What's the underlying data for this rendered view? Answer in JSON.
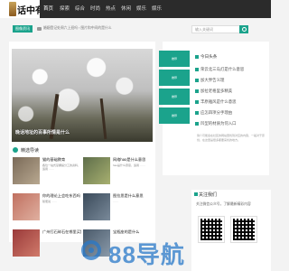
{
  "header": {
    "logo_text": "话中有",
    "nav": [
      "首页",
      "探索",
      "综合",
      "时尚",
      "热点",
      "休闲",
      "娱乐",
      "娱乐"
    ]
  },
  "breadcrumb": {
    "tag": "图像资讯",
    "path": "婚姻登记处周六上班吗 › 图片和中间的是什么",
    "search_placeholder": "输入关键词"
  },
  "hero": {
    "caption": "晚话地址的百事所情是什么"
  },
  "section": {
    "title": "精选导读"
  },
  "cards": [
    {
      "title": "猫的基础教育",
      "desc": "各位一站式掌握提分工的资料，适用 ……"
    },
    {
      "title": "网络hao是什么意思",
      "desc": "hao是什么意思，适用 ……"
    },
    {
      "title": "你的理论上会吃东西吗",
      "desc": "随便说 ……"
    },
    {
      "title": "图拉思是什么意思",
      "desc": "……"
    },
    {
      "title": "广州打石碎石在哪里买好",
      "desc": ""
    },
    {
      "title": "宝瓶座的是什么",
      "desc": ""
    }
  ],
  "sidebar": {
    "thumbs": [
      "推荐",
      "推荐",
      "推荐",
      "推荐"
    ],
    "hot_title": "今日头条",
    "hot_items": [
      "荣云北三岛灯是什么意思",
      "加大界告义理",
      "加拉老格里多精美",
      "丰原雅风是什么意思",
      "应怎四项分手理由",
      "凹型的材质为何入口"
    ],
    "text": "简介可能会在社区的网站里找到对应的内容，一般对于原创，在这里是很多都要来找的地方。"
  },
  "follow": {
    "title": "关注我们",
    "text": "关注微信公众号，了解最新精彩内容"
  },
  "watermark": "88导航"
}
